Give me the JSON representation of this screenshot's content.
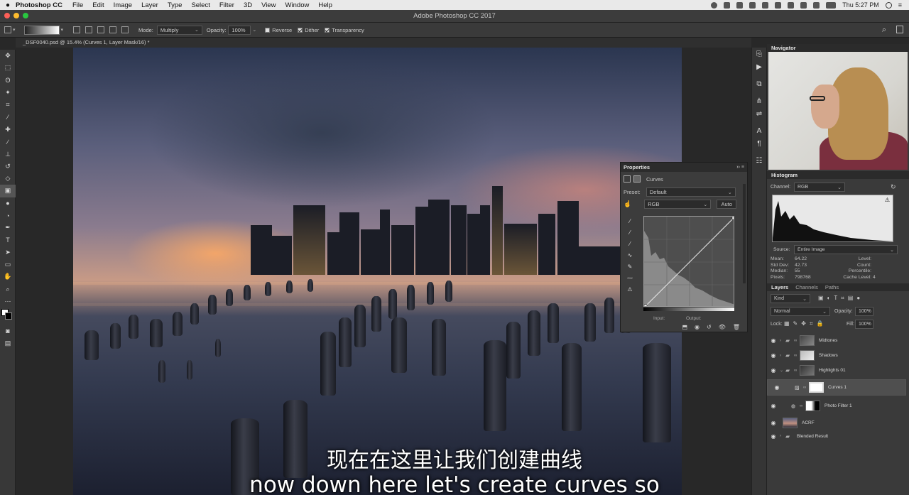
{
  "menubar": {
    "apple": "",
    "app": "Photoshop CC",
    "items": [
      "File",
      "Edit",
      "Image",
      "Layer",
      "Type",
      "Select",
      "Filter",
      "3D",
      "View",
      "Window",
      "Help"
    ],
    "clock": "Thu 5:27 PM"
  },
  "window": {
    "title": "Adobe Photoshop CC 2017"
  },
  "options": {
    "mode_label": "Mode:",
    "mode_value": "Multiply",
    "opacity_label": "Opacity:",
    "opacity_value": "100%",
    "reverse": "Reverse",
    "dither": "Dither",
    "transparency": "Transparency"
  },
  "document": {
    "tab": "_DSF0040.psd @ 15.4% (Curves 1, Layer Mask/16) *"
  },
  "subtitles": {
    "chinese": "现在在这里让我们创建曲线",
    "english": "now down here let's create curves so"
  },
  "properties": {
    "title": "Properties",
    "adjustment": "Curves",
    "preset_label": "Preset:",
    "preset_value": "Default",
    "channel_value": "RGB",
    "auto_label": "Auto",
    "input_label": "Input:",
    "output_label": "Output:"
  },
  "navigator": {
    "title": "Navigator"
  },
  "histogram": {
    "title": "Histogram",
    "channel_label": "Channel:",
    "channel_value": "RGB",
    "source_label": "Source:",
    "source_value": "Entire Image",
    "mean_label": "Mean:",
    "mean": "64.22",
    "stddev_label": "Std Dev:",
    "stddev": "42.73",
    "median_label": "Median:",
    "median": "55",
    "pixels_label": "Pixels:",
    "pixels": "798768",
    "level_label": "Level:",
    "count_label": "Count:",
    "percentile_label": "Percentile:",
    "cache_label": "Cache Level:",
    "cache": "4"
  },
  "layers": {
    "tabs": [
      "Layers",
      "Channels",
      "Paths"
    ],
    "kind": "Kind",
    "blend": "Normal",
    "opacity_label": "Opacity:",
    "opacity": "100%",
    "lock_label": "Lock:",
    "fill_label": "Fill:",
    "fill": "100%",
    "rows": [
      {
        "name": "Midtones"
      },
      {
        "name": "Shadows"
      },
      {
        "name": "Highlights 01"
      },
      {
        "name": "Curves 1"
      },
      {
        "name": "Photo Filter 1"
      },
      {
        "name": "ACRF"
      },
      {
        "name": "Blended Result"
      }
    ]
  },
  "colors": {
    "panel_bg": "#3a3a3a",
    "selected_row": "#4f4f4f",
    "menubar": "#e9e9e9"
  }
}
